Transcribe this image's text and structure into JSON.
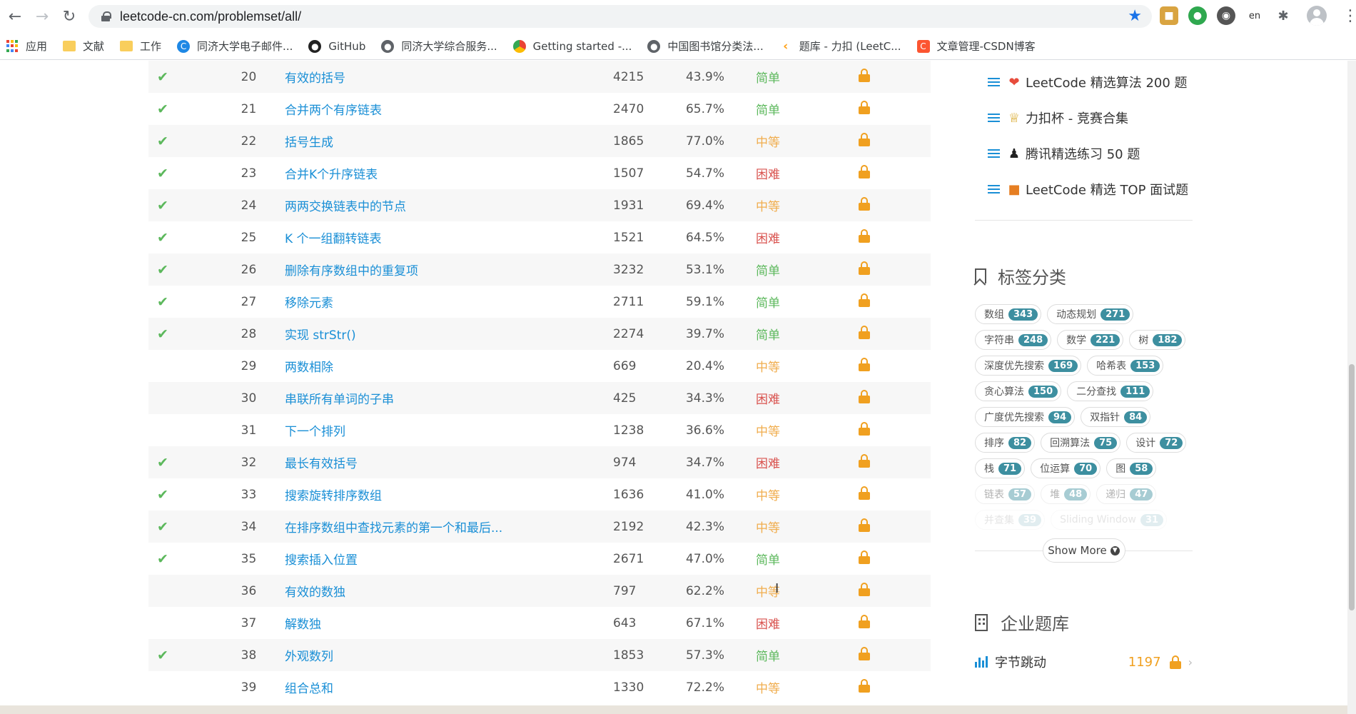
{
  "browser": {
    "url": "leetcode-cn.com/problemset/all/",
    "bookmarks": [
      {
        "label": "应用",
        "icon": "apps-grid-icon"
      },
      {
        "label": "文献",
        "icon": "folder-icon"
      },
      {
        "label": "工作",
        "icon": "folder-icon"
      },
      {
        "label": "同济大学电子邮件...",
        "icon": "c-logo-icon"
      },
      {
        "label": "GitHub",
        "icon": "github-icon"
      },
      {
        "label": "同济大学综合服务...",
        "icon": "globe-icon"
      },
      {
        "label": "Getting started -...",
        "icon": "chrome-icon"
      },
      {
        "label": "中国图书馆分类法...",
        "icon": "globe-icon"
      },
      {
        "label": "题库 - 力扣 (LeetC...",
        "icon": "leetcode-icon"
      },
      {
        "label": "文章管理-CSDN博客",
        "icon": "csdn-icon"
      }
    ]
  },
  "problems": [
    {
      "solved": true,
      "id": "20",
      "title": "有效的括号",
      "solutions": "4215",
      "rate": "43.9%",
      "difficulty": "简单",
      "level": "easy"
    },
    {
      "solved": true,
      "id": "21",
      "title": "合并两个有序链表",
      "solutions": "2470",
      "rate": "65.7%",
      "difficulty": "简单",
      "level": "easy"
    },
    {
      "solved": true,
      "id": "22",
      "title": "括号生成",
      "solutions": "1865",
      "rate": "77.0%",
      "difficulty": "中等",
      "level": "med"
    },
    {
      "solved": true,
      "id": "23",
      "title": "合并K个升序链表",
      "solutions": "1507",
      "rate": "54.7%",
      "difficulty": "困难",
      "level": "hard"
    },
    {
      "solved": true,
      "id": "24",
      "title": "两两交换链表中的节点",
      "solutions": "1931",
      "rate": "69.4%",
      "difficulty": "中等",
      "level": "med"
    },
    {
      "solved": true,
      "id": "25",
      "title": "K 个一组翻转链表",
      "solutions": "1521",
      "rate": "64.5%",
      "difficulty": "困难",
      "level": "hard"
    },
    {
      "solved": true,
      "id": "26",
      "title": "删除有序数组中的重复项",
      "solutions": "3232",
      "rate": "53.1%",
      "difficulty": "简单",
      "level": "easy"
    },
    {
      "solved": true,
      "id": "27",
      "title": "移除元素",
      "solutions": "2711",
      "rate": "59.1%",
      "difficulty": "简单",
      "level": "easy"
    },
    {
      "solved": true,
      "id": "28",
      "title": "实现 strStr()",
      "solutions": "2274",
      "rate": "39.7%",
      "difficulty": "简单",
      "level": "easy"
    },
    {
      "solved": false,
      "id": "29",
      "title": "两数相除",
      "solutions": "669",
      "rate": "20.4%",
      "difficulty": "中等",
      "level": "med"
    },
    {
      "solved": false,
      "id": "30",
      "title": "串联所有单词的子串",
      "solutions": "425",
      "rate": "34.3%",
      "difficulty": "困难",
      "level": "hard"
    },
    {
      "solved": false,
      "id": "31",
      "title": "下一个排列",
      "solutions": "1238",
      "rate": "36.6%",
      "difficulty": "中等",
      "level": "med"
    },
    {
      "solved": true,
      "id": "32",
      "title": "最长有效括号",
      "solutions": "974",
      "rate": "34.7%",
      "difficulty": "困难",
      "level": "hard"
    },
    {
      "solved": true,
      "id": "33",
      "title": "搜索旋转排序数组",
      "solutions": "1636",
      "rate": "41.0%",
      "difficulty": "中等",
      "level": "med"
    },
    {
      "solved": true,
      "id": "34",
      "title": "在排序数组中查找元素的第一个和最后...",
      "solutions": "2192",
      "rate": "42.3%",
      "difficulty": "中等",
      "level": "med"
    },
    {
      "solved": true,
      "id": "35",
      "title": "搜索插入位置",
      "solutions": "2671",
      "rate": "47.0%",
      "difficulty": "简单",
      "level": "easy"
    },
    {
      "solved": false,
      "id": "36",
      "title": "有效的数独",
      "solutions": "797",
      "rate": "62.2%",
      "difficulty": "中等",
      "level": "med"
    },
    {
      "solved": false,
      "id": "37",
      "title": "解数独",
      "solutions": "643",
      "rate": "67.1%",
      "difficulty": "困难",
      "level": "hard"
    },
    {
      "solved": true,
      "id": "38",
      "title": "外观数列",
      "solutions": "1853",
      "rate": "57.3%",
      "difficulty": "简单",
      "level": "easy"
    },
    {
      "solved": false,
      "id": "39",
      "title": "组合总和",
      "solutions": "1330",
      "rate": "72.2%",
      "difficulty": "中等",
      "level": "med"
    }
  ],
  "sidebar": {
    "favorites": [
      {
        "emoji": "❤",
        "label": "LeetCode 精选算法 200 题",
        "icon": "heart-icon",
        "color": "#e74c3c"
      },
      {
        "emoji": "🏆",
        "label": "力扣杯 - 竞赛合集",
        "icon": "trophy-icon",
        "color": "#d4a017"
      },
      {
        "emoji": "🐧",
        "label": "腾讯精选练习 50 题",
        "icon": "penguin-icon",
        "color": "#222222"
      },
      {
        "emoji": "🧑",
        "label": "LeetCode 精选 TOP 面试题",
        "icon": "interview-icon",
        "color": "#e67e22"
      }
    ],
    "tags_title": "标签分类",
    "tags": [
      {
        "name": "数组",
        "count": "343"
      },
      {
        "name": "动态规划",
        "count": "271"
      },
      {
        "name": "字符串",
        "count": "248"
      },
      {
        "name": "数学",
        "count": "221"
      },
      {
        "name": "树",
        "count": "182"
      },
      {
        "name": "深度优先搜索",
        "count": "169"
      },
      {
        "name": "哈希表",
        "count": "153"
      },
      {
        "name": "贪心算法",
        "count": "150"
      },
      {
        "name": "二分查找",
        "count": "111"
      },
      {
        "name": "广度优先搜索",
        "count": "94"
      },
      {
        "name": "双指针",
        "count": "84"
      },
      {
        "name": "排序",
        "count": "82"
      },
      {
        "name": "回溯算法",
        "count": "75"
      },
      {
        "name": "设计",
        "count": "72"
      },
      {
        "name": "栈",
        "count": "71"
      },
      {
        "name": "位运算",
        "count": "70"
      },
      {
        "name": "图",
        "count": "58"
      },
      {
        "name": "链表",
        "count": "57"
      },
      {
        "name": "堆",
        "count": "48"
      },
      {
        "name": "递归",
        "count": "47"
      },
      {
        "name": "并查集",
        "count": "39"
      },
      {
        "name": "Sliding Window",
        "count": "31"
      }
    ],
    "show_more": "Show More",
    "company_title": "企业题库",
    "companies": [
      {
        "name": "字节跳动",
        "count": "1197"
      }
    ]
  }
}
